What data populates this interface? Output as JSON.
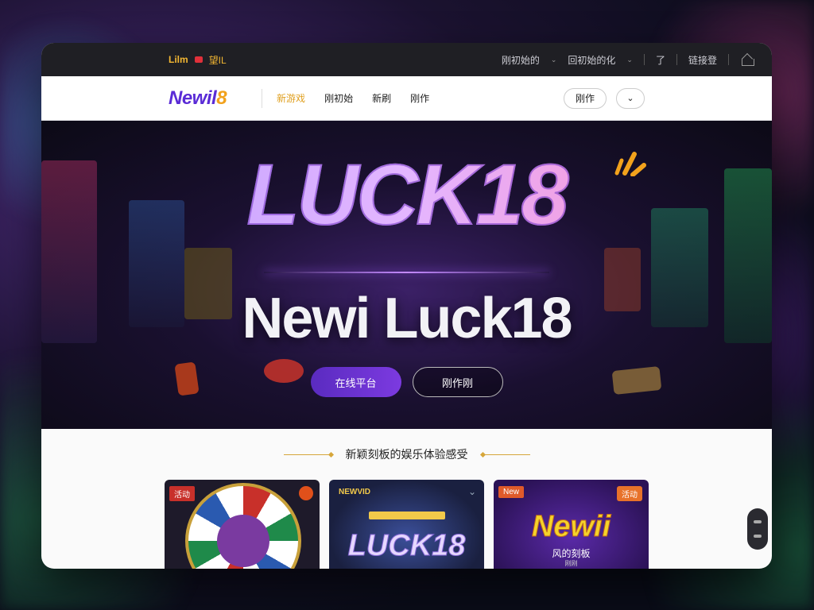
{
  "topbar": {
    "logo": "Lilm",
    "promo": "望IL",
    "links": [
      "刚初始的",
      "回初始的化",
      "了"
    ],
    "login": "链接登"
  },
  "navbar": {
    "brand_main": "Newil",
    "brand_accent": "8",
    "links": [
      "新游戏",
      "刚初始",
      "新刷",
      "刚作"
    ],
    "search_label": "刚作",
    "dropdown": "⌄"
  },
  "hero": {
    "title": "LUCK18",
    "subtitle": "Newi Luck18",
    "primary_button": "在线平台",
    "secondary_button": "刚作刚"
  },
  "section": {
    "heading": "新颖刻板的娱乐体验感受"
  },
  "cards": [
    {
      "tag": "活动",
      "title": ""
    },
    {
      "tag": "NEWVID",
      "title": "LUCK18"
    },
    {
      "tag": "New",
      "badge": "活动",
      "title": "Newii",
      "subtitle": "风的刻板",
      "caption": "刚刚"
    }
  ],
  "colors": {
    "accent_purple": "#5a2bd6",
    "accent_gold": "#f2a21c",
    "button_purple": "#6a32d0"
  }
}
